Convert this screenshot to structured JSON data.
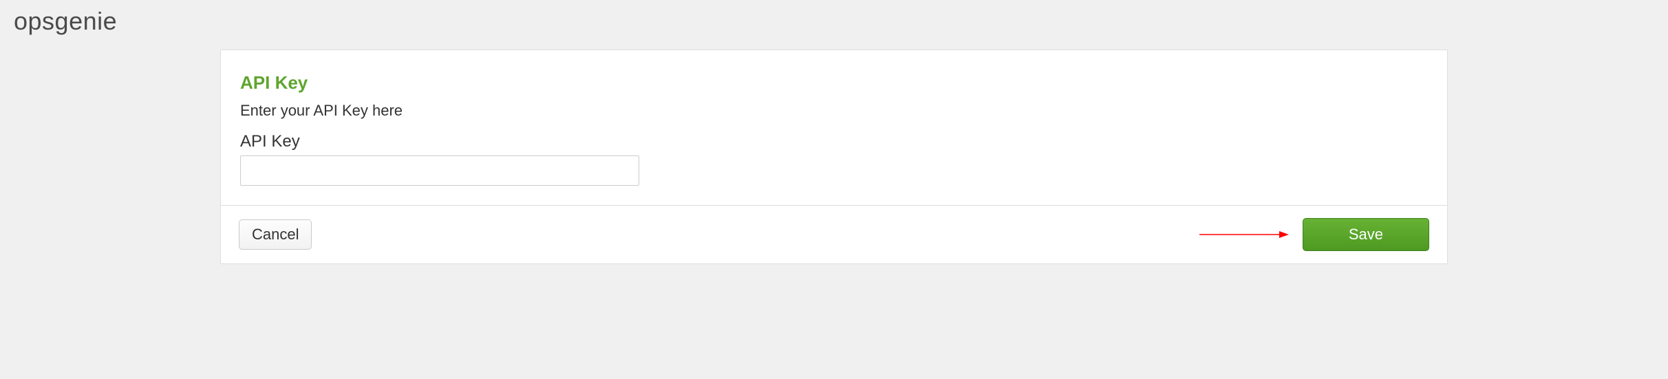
{
  "page": {
    "title": "opsgenie"
  },
  "section": {
    "heading": "API Key",
    "description": "Enter your API Key here",
    "field_label": "API Key",
    "field_value": "",
    "field_placeholder": ""
  },
  "actions": {
    "cancel_label": "Cancel",
    "save_label": "Save"
  }
}
